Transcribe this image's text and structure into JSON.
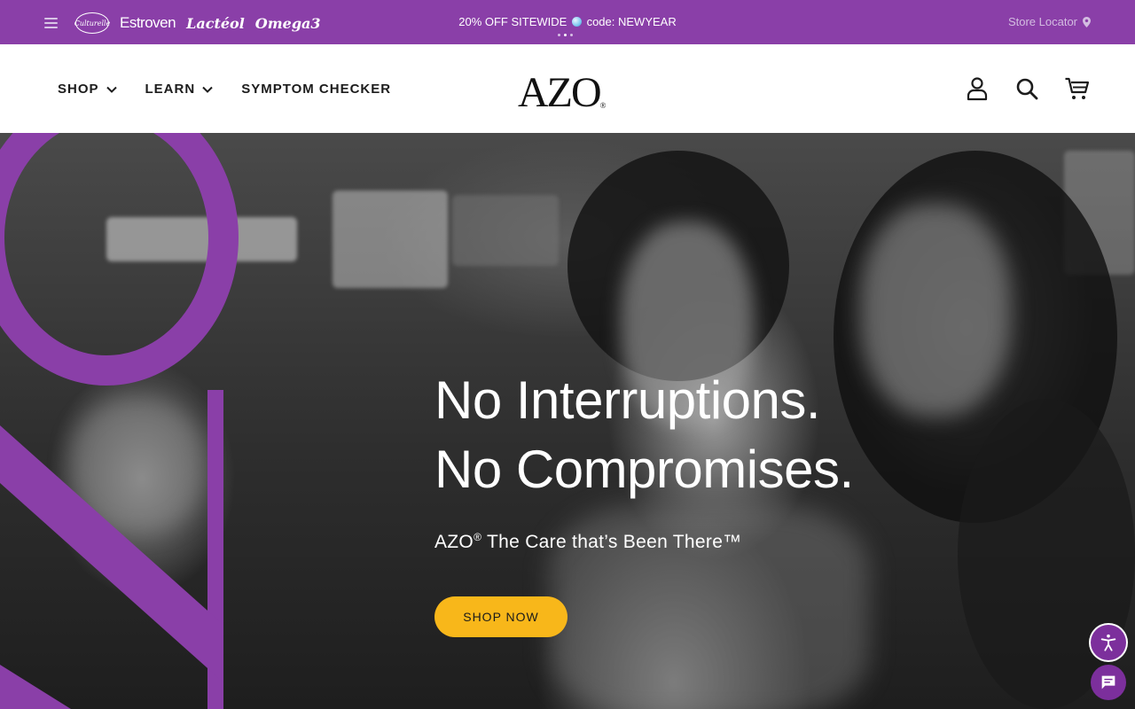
{
  "promo_bar": {
    "background": "#8a3fa8",
    "brands": [
      "Culturelle",
      "Estroven",
      "Lactéol",
      "Omega3"
    ],
    "message_before": "20% OFF SITEWIDE",
    "message_after": "code: NEWYEAR",
    "carousel_dots": 3,
    "active_dot": 2,
    "store_locator": "Store Locator"
  },
  "header": {
    "nav": [
      {
        "label": "SHOP",
        "has_dropdown": true
      },
      {
        "label": "LEARN",
        "has_dropdown": true
      },
      {
        "label": "SYMPTOM CHECKER",
        "has_dropdown": false
      }
    ],
    "logo": "AZO",
    "logo_mark": "®",
    "icons": [
      "account-icon",
      "search-icon",
      "cart-icon"
    ]
  },
  "hero": {
    "headline_line1": "No Interruptions.",
    "headline_line2": "No Compromises.",
    "sub_brand": "AZO",
    "sub_mark": "®",
    "sub_text": " The Care that’s Been There™",
    "cta": "SHOP NOW",
    "cta_color": "#f8b71a",
    "accent_color": "#8a3fa8"
  },
  "widgets": {
    "accessibility": "accessibility-icon",
    "chat": "chat-icon"
  }
}
